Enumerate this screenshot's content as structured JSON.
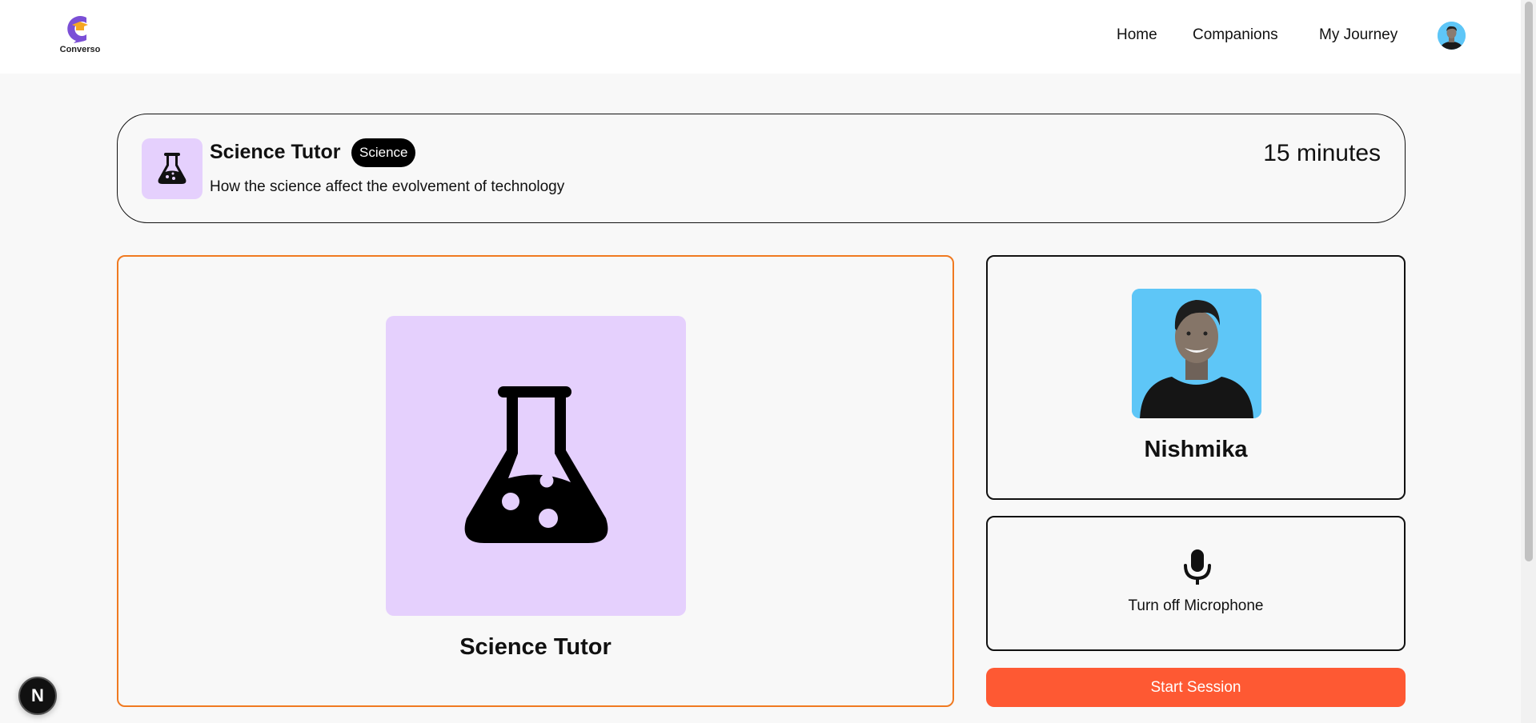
{
  "app": {
    "logo_text": "Converso"
  },
  "nav": {
    "home": "Home",
    "companions": "Companions",
    "journey": "My Journey"
  },
  "session": {
    "companion_name": "Science Tutor",
    "subject": "Science",
    "topic": "How the science affect the evolvement of technology",
    "duration": "15 minutes"
  },
  "user": {
    "name": "Nishmika"
  },
  "controls": {
    "mic_label": "Turn off Microphone",
    "start_label": "Start Session"
  },
  "dev_badge": "N",
  "colors": {
    "accent": "#fe5933",
    "companion_border": "#f07a21",
    "subject_bg": "#e5d0fd",
    "photo_bg": "#5ec6f7"
  },
  "icons": {
    "subject_icon": "flask-icon",
    "mic_icon": "microphone-icon"
  }
}
